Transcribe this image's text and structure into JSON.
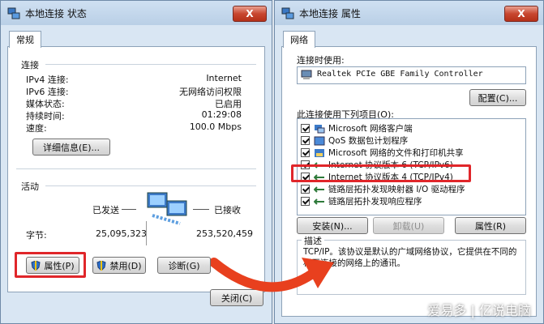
{
  "status_window": {
    "title": "本地连接 状态",
    "close_label": "X",
    "tab": "常规",
    "connection_section": "连接",
    "rows": [
      {
        "label": "IPv4 连接:",
        "value": "Internet"
      },
      {
        "label": "IPv6 连接:",
        "value": "无网络访问权限"
      },
      {
        "label": "媒体状态:",
        "value": "已启用"
      },
      {
        "label": "持续时间:",
        "value": "01:29:08"
      },
      {
        "label": "速度:",
        "value": "100.0 Mbps"
      }
    ],
    "details_button": "详细信息(E)...",
    "activity_section": "活动",
    "sent_label": "已发送",
    "received_label": "已接收",
    "bytes_label": "字节:",
    "bytes_sent": "25,095,323",
    "bytes_received": "253,520,459",
    "properties_button": "属性(P)",
    "disable_button": "禁用(D)",
    "diagnose_button": "诊断(G)",
    "close_button": "关闭(C)"
  },
  "properties_window": {
    "title": "本地连接 属性",
    "close_label": "X",
    "tab": "网络",
    "connect_using_label": "连接时使用:",
    "adapter_name": "Realtek PCIe GBE Family Controller",
    "configure_button": "配置(C)...",
    "items_label": "此连接使用下列项目(O):",
    "items": [
      {
        "label": "Microsoft 网络客户端",
        "icon": "network-client-icon"
      },
      {
        "label": "QoS 数据包计划程序",
        "icon": "qos-icon"
      },
      {
        "label": "Microsoft 网络的文件和打印机共享",
        "icon": "file-share-icon"
      },
      {
        "label": "Internet 协议版本 6 (TCP/IPv6)",
        "icon": "protocol-icon"
      },
      {
        "label": "Internet 协议版本 4 (TCP/IPv4)",
        "icon": "protocol-icon"
      },
      {
        "label": "链路层拓扑发现映射器 I/O 驱动程序",
        "icon": "protocol-icon"
      },
      {
        "label": "链路层拓扑发现响应程序",
        "icon": "protocol-icon"
      }
    ],
    "install_button": "安装(N)...",
    "uninstall_button": "卸载(U)",
    "properties_button": "属性(R)",
    "description_label": "描述",
    "description_text": "TCP/IP。该协议是默认的广域网络协议，它提供在不同的相互连接的网络上的通讯。"
  },
  "watermark": "爱易多 | 亿说电脑",
  "colors": {
    "highlight": "#e0262a",
    "arrow": "#e8401e"
  }
}
